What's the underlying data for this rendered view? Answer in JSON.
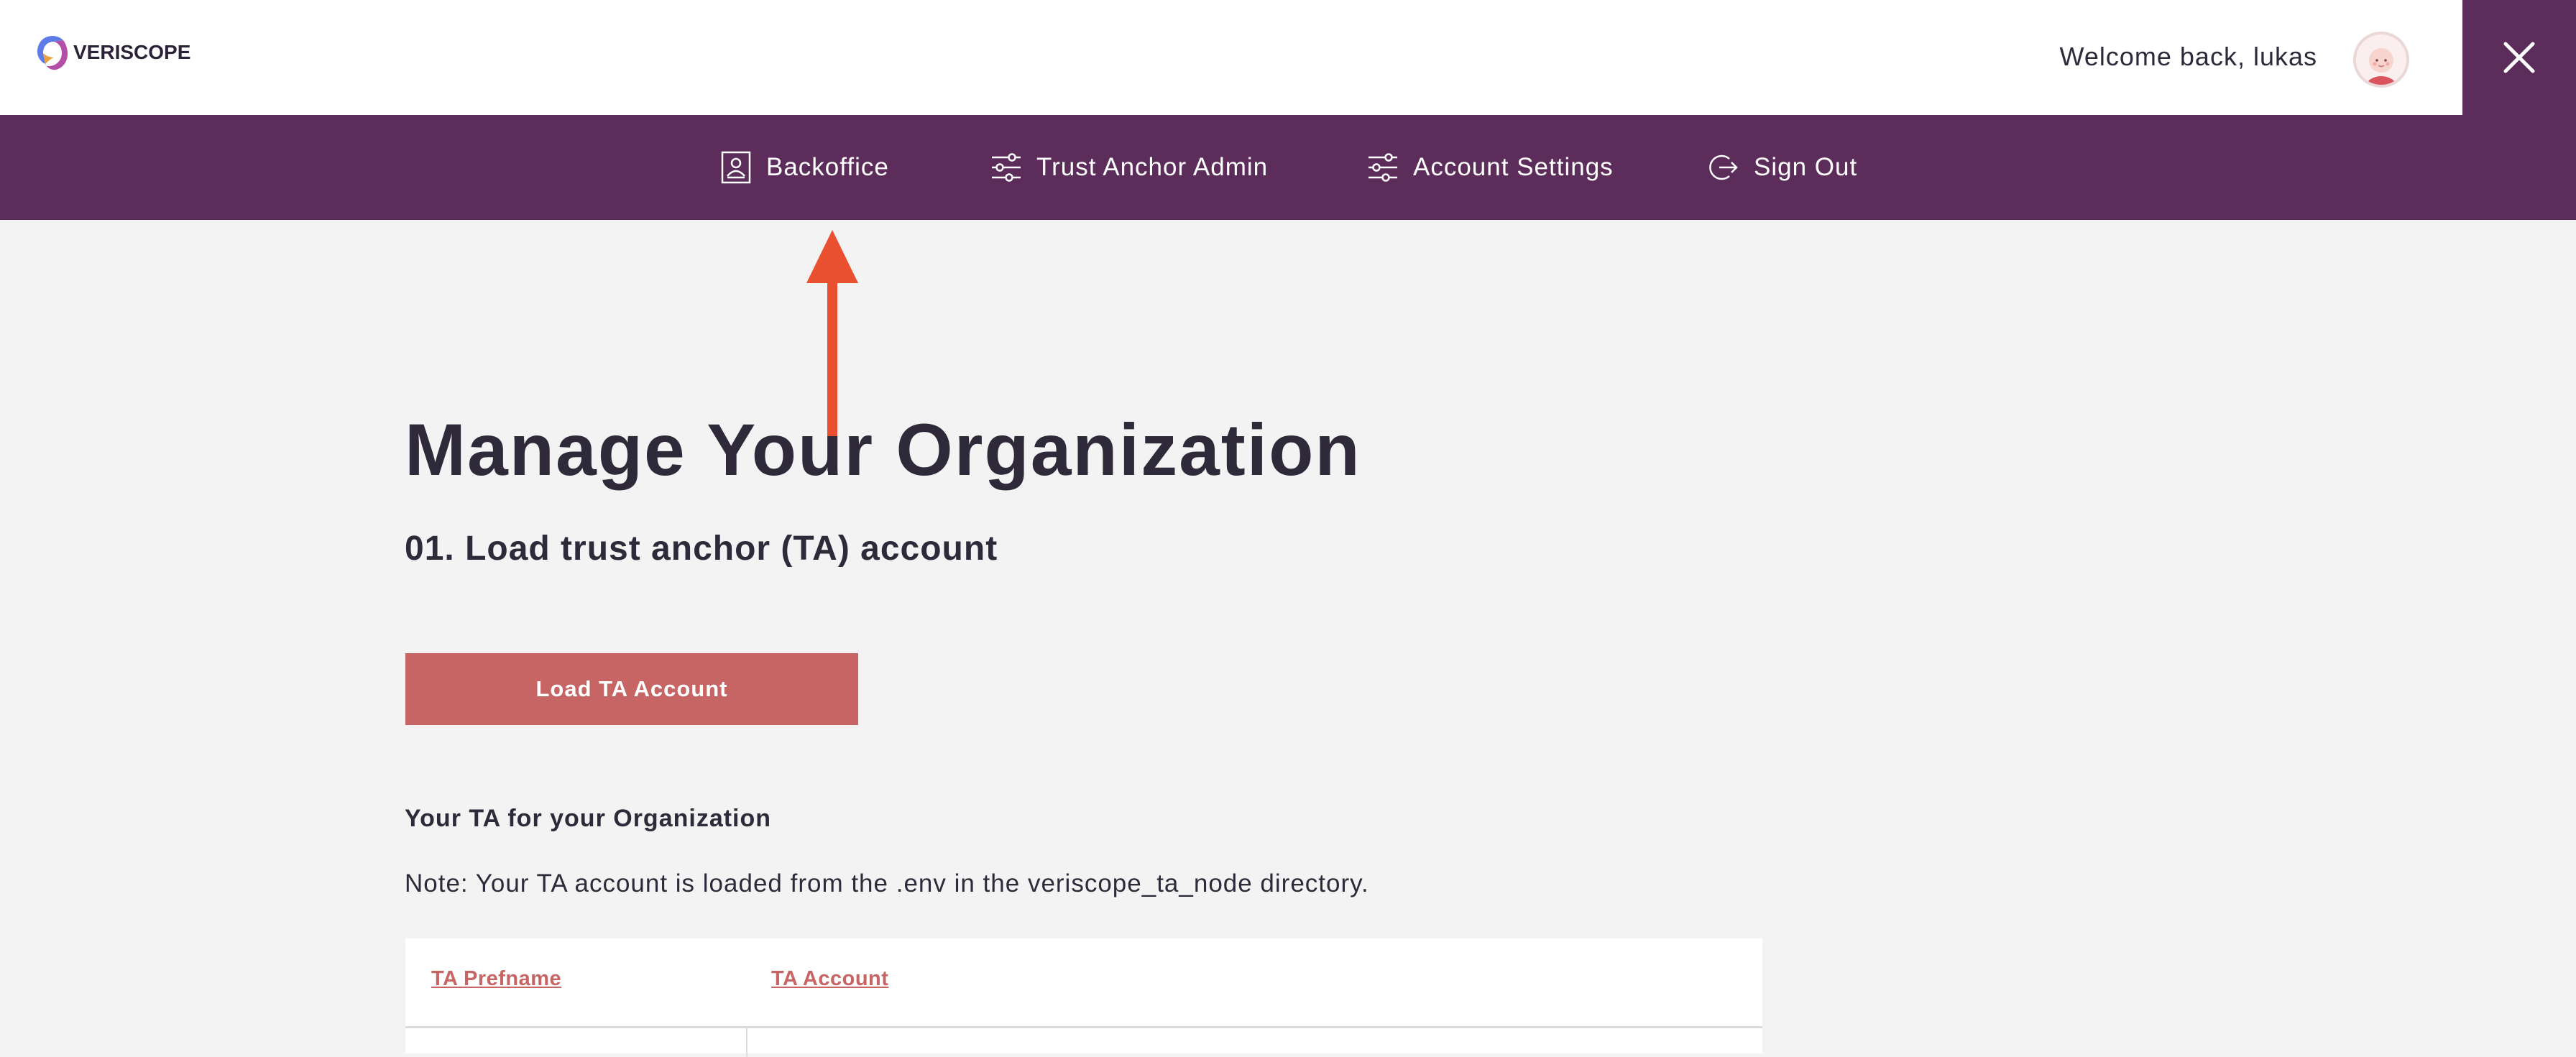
{
  "header": {
    "logo_text": "VERISCOPE",
    "welcome_text": "Welcome back, lukas",
    "close_icon": "close-icon"
  },
  "nav": {
    "items": [
      {
        "label": "Backoffice",
        "icon": "portrait-icon"
      },
      {
        "label": "Trust Anchor Admin",
        "icon": "sliders-icon"
      },
      {
        "label": "Account Settings",
        "icon": "sliders-icon"
      },
      {
        "label": "Sign Out",
        "icon": "sign-out-icon"
      }
    ]
  },
  "annotation": {
    "arrow_color": "#e8502f"
  },
  "main": {
    "title": "Manage Your Organization",
    "step_title": "01. Load trust anchor (TA) account",
    "load_button": "Load TA Account",
    "subheading": "Your TA for your Organization",
    "note": "Note: Your TA account is loaded from the .env in the veriscope_ta_node directory.",
    "table": {
      "columns": [
        "TA Prefname",
        "TA Account"
      ]
    }
  },
  "colors": {
    "brand_purple": "#5c2d5b",
    "accent_red": "#c66564",
    "background": "#f4f3f4",
    "text": "#2f2a3a"
  }
}
